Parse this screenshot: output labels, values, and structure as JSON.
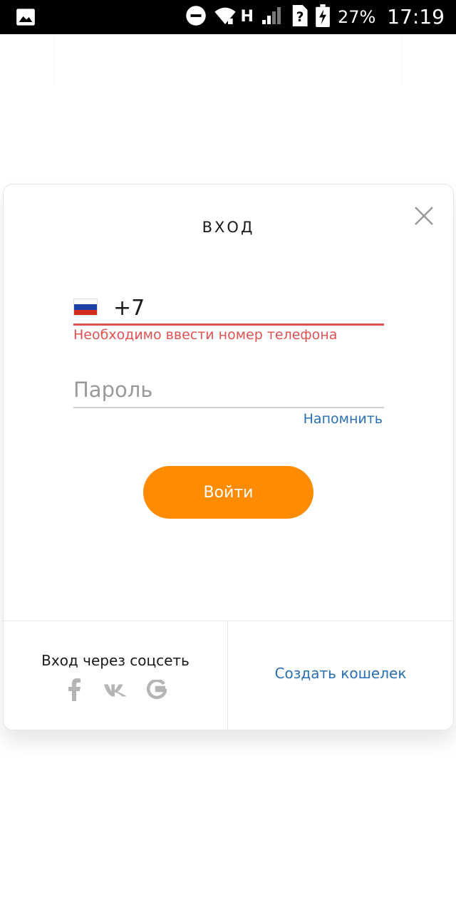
{
  "status_bar": {
    "network_label": "H",
    "battery_percent": "27%",
    "time": "17:19"
  },
  "login": {
    "title": "ВХОД",
    "phone": {
      "country_flag": "russia-flag-icon",
      "value": "+7",
      "error": "Необходимо ввести номер телефона"
    },
    "password": {
      "placeholder": "Пароль"
    },
    "remind_label": "Напомнить",
    "submit_label": "Войти"
  },
  "footer": {
    "social_title": "Вход через соцсеть",
    "social_icons": [
      "facebook-icon",
      "vk-icon",
      "google-icon"
    ],
    "create_wallet_label": "Создать кошелек"
  },
  "colors": {
    "accent": "#ff8c00",
    "error": "#e05252",
    "link": "#2a6fb3"
  }
}
